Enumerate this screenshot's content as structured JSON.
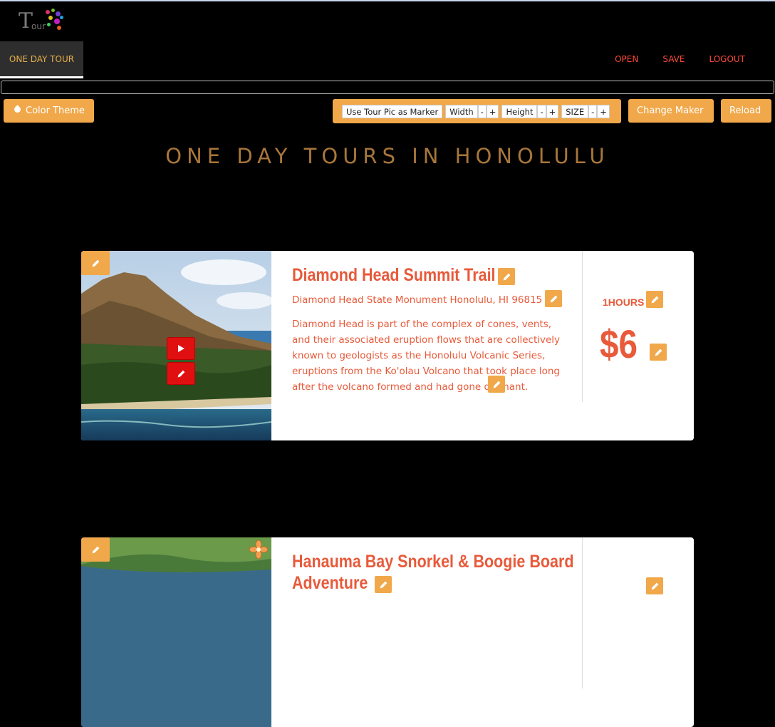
{
  "app": {
    "logo_text": "T",
    "logo_subtext": "our"
  },
  "nav": {
    "active_tab": "ONE DAY TOUR",
    "links": [
      "OPEN",
      "SAVE",
      "LOGOUT"
    ]
  },
  "toolbar": {
    "color_theme": "Color Theme",
    "use_tour_pic": "Use Tour Pic as Marker",
    "width": "Width",
    "height": "Height",
    "size": "SIZE",
    "minus": "-",
    "plus": "+",
    "change_maker": "Change Maker",
    "reload": "Reload"
  },
  "page": {
    "title": "ONE DAY TOURS IN HONOLULU"
  },
  "tours": [
    {
      "title": "Diamond Head Summit Trail",
      "address": "Diamond Head State Monument Honolulu, HI 96815",
      "description": "Diamond Head is part of the complex of cones, vents, and their associated eruption flows that are collectively known to geologists as the Honolulu Volcanic Series, eruptions from the Ko'olau Volcano that took place long after the volcano formed and had gone dormant.",
      "hours": "1HOURS",
      "price": "$6"
    },
    {
      "title_line1": "Hanauma Bay Snorkel & Boogie Board",
      "title_line2": "Adventure"
    }
  ],
  "colors": {
    "accent": "#f0a84a",
    "text_red": "#e85a3a",
    "nav_link": "#ff4a3a",
    "title_gold": "#a8763a",
    "video_red": "#e01010"
  },
  "icons": [
    "pencil-icon",
    "play-icon",
    "water-drop-icon",
    "flower-icon"
  ]
}
